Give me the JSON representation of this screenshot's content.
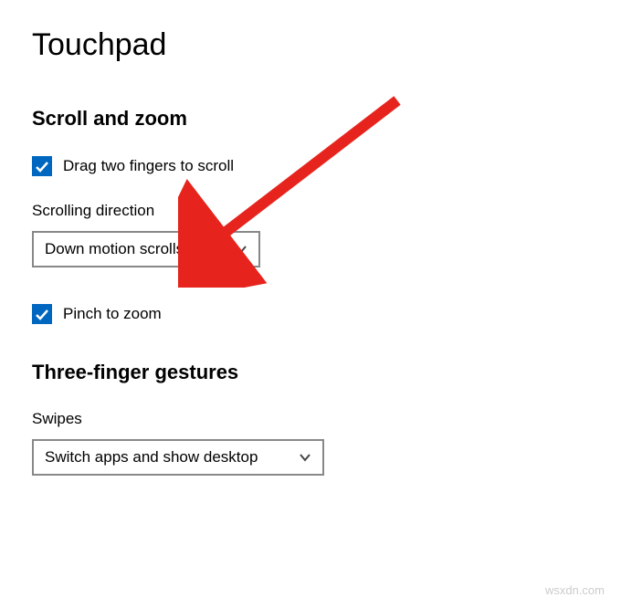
{
  "page": {
    "title": "Touchpad"
  },
  "scroll_and_zoom": {
    "header": "Scroll and zoom",
    "drag_two_fingers": {
      "label": "Drag two fingers to scroll",
      "checked": true
    },
    "scrolling_direction": {
      "label": "Scrolling direction",
      "selected": "Down motion scrolls up"
    },
    "pinch_to_zoom": {
      "label": "Pinch to zoom",
      "checked": true
    }
  },
  "three_finger": {
    "header": "Three-finger gestures",
    "swipes": {
      "label": "Swipes",
      "selected": "Switch apps and show desktop"
    }
  },
  "annotation": {
    "arrow_color": "#e6241d"
  },
  "watermark": "wsxdn.com"
}
